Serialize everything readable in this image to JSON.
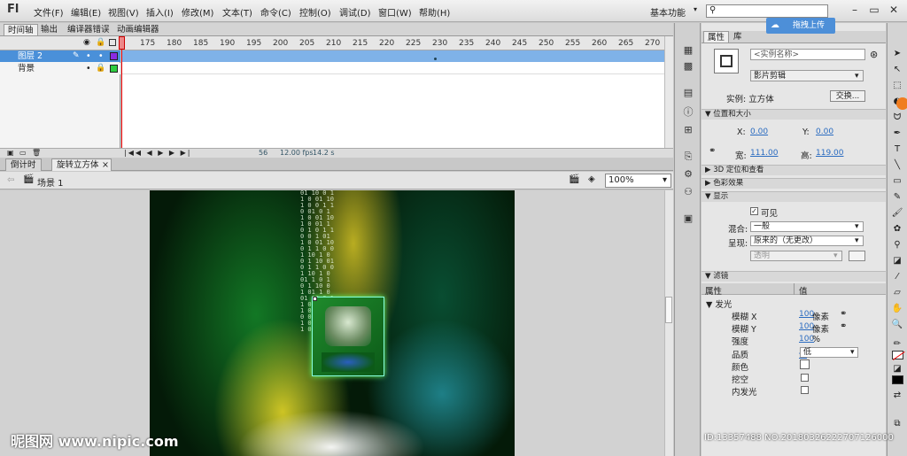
{
  "app": {
    "logo": "Fl",
    "workspace": "基本功能"
  },
  "menu": [
    "文件(F)",
    "编辑(E)",
    "视图(V)",
    "插入(I)",
    "修改(M)",
    "文本(T)",
    "命令(C)",
    "控制(O)",
    "调试(D)",
    "窗口(W)",
    "帮助(H)"
  ],
  "search": {
    "icon": "search-icon",
    "value": ""
  },
  "window_buttons": {
    "minimize": "–",
    "restore": "▭",
    "close": "✕"
  },
  "upload": {
    "label": "拖拽上传",
    "icon": "cloud-icon"
  },
  "timeline": {
    "tabs": [
      "时间轴",
      "输出",
      "编译器错误",
      "动画编辑器"
    ],
    "frame_numbers": [
      "175",
      "180",
      "185",
      "190",
      "195",
      "200",
      "205",
      "210",
      "215",
      "220",
      "225",
      "230",
      "235",
      "240",
      "245",
      "250",
      "255",
      "260",
      "265",
      "270"
    ],
    "layers": [
      {
        "name": "图层 2",
        "color": "#8a2be2",
        "selected": true
      },
      {
        "name": "背景",
        "color": "#2ecc40",
        "selected": false
      }
    ],
    "footer": {
      "frame": "56",
      "fps": "12.00 fps",
      "time": "14.2 s"
    }
  },
  "doc_tabs": [
    {
      "label": "倒计时",
      "active": false
    },
    {
      "label": "旋转立方体",
      "active": true,
      "close": "×"
    }
  ],
  "editbar": {
    "scene": "场景 1",
    "zoom": "100%"
  },
  "stage": {
    "code_text": "01 10 0 1 1 0 01 10 1 0 0 1 10 01 0 1 1 0 01 10 1 0 01 1 0 1 0 1 10 0 1 01 1 0 01 10 0 1 1 0 01 10 1 0 0 1 10 01 0 1 1 0 01 10 1 0 01 1 0 1 0 1 10 0 1 01 1 0 01 10 0 1 1 0 01 10 1 0 0 1 10 01 0 1 1 0 01 10 1 0",
    "watermark": "昵图网 www.nipic.com"
  },
  "properties": {
    "tabs": [
      "属性",
      "库"
    ],
    "instance_name_placeholder": "<实例名称>",
    "instance_type": "影片剪辑",
    "instance_of_label": "实例: 立方体",
    "swap_button": "交换...",
    "sections": {
      "position": "位置和大小",
      "3d": "3D 定位和查看",
      "color": "色彩效果",
      "display": "显示",
      "filter": "滤镜"
    },
    "x_label": "X:",
    "x_value": "0.00",
    "y_label": "Y:",
    "y_value": "0.00",
    "w_label": "宽:",
    "w_value": "111.00",
    "h_label": "高:",
    "h_value": "119.00",
    "visible_label": "可见",
    "blend_label": "混合:",
    "blend_value": "一般",
    "render_label": "呈现:",
    "render_value": "原来的（无更改）",
    "transparent_value": "透明",
    "filter_table": {
      "col_prop": "属性",
      "col_value": "值",
      "group": "发光",
      "rows": [
        {
          "label": "模糊 X",
          "value": "100",
          "unit": "像素",
          "link": true
        },
        {
          "label": "模糊 Y",
          "value": "100",
          "unit": "像素",
          "link": true
        },
        {
          "label": "强度",
          "value": "100",
          "unit": "%"
        },
        {
          "label": "品质",
          "value": "低",
          "select": true
        },
        {
          "label": "颜色",
          "swatch": true
        },
        {
          "label": "挖空",
          "checkbox": true
        },
        {
          "label": "内发光",
          "checkbox": true
        }
      ]
    }
  },
  "id_watermark": "ID:13357488 NO:20180326222707126000"
}
